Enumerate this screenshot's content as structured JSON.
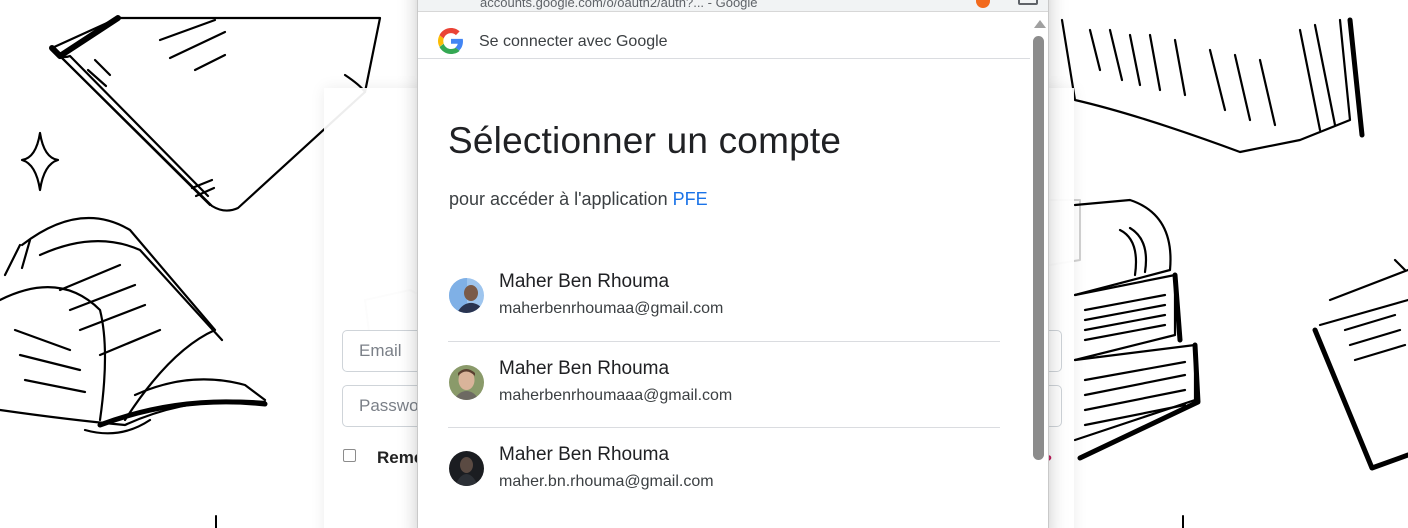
{
  "background": {
    "email_placeholder": "Email",
    "password_placeholder": "Passwo",
    "remember_label": "Reme",
    "forgot_fragment": "?"
  },
  "browser": {
    "url_fragment": "accounts.google.com/o/oauth2/auth?... - Google"
  },
  "popup": {
    "header_text": "Se connecter avec Google",
    "title": "Sélectionner un compte",
    "subtitle_prefix": "pour accéder à l'application ",
    "app_name": "PFE",
    "accounts": [
      {
        "name": "Maher Ben Rhouma",
        "email": "maherbenrhoumaa@gmail.com"
      },
      {
        "name": "Maher Ben Rhouma",
        "email": "maherbenrhoumaaa@gmail.com"
      },
      {
        "name": "Maher Ben Rhouma",
        "email": "maher.bn.rhouma@gmail.com"
      }
    ]
  },
  "colors": {
    "link_blue": "#1a73e8",
    "google_blue": "#4285F4",
    "google_red": "#EA4335",
    "google_yellow": "#FBBC05",
    "google_green": "#34A853"
  },
  "icons": {
    "header_logo": "google-g-logo",
    "account_avatar": "profile-photo"
  }
}
